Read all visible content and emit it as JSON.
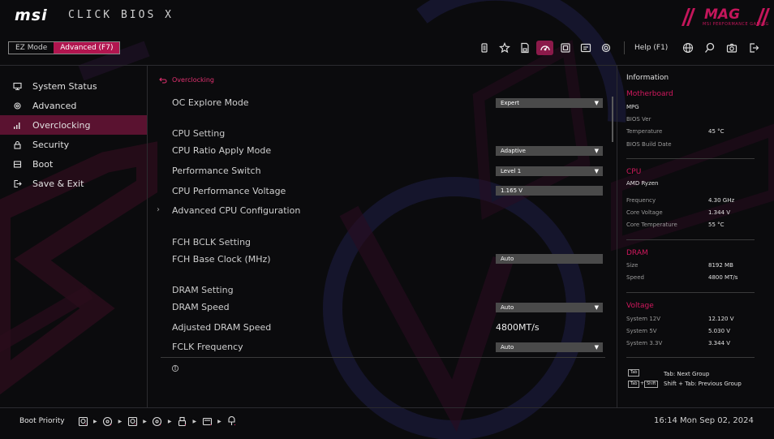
{
  "header": {
    "logo": "msi",
    "title": "CLICK BIOS X",
    "brand": "MAG",
    "brand_tagline": "MSI PERFORMANCE GAMING"
  },
  "mode_switch": {
    "ez_label": "EZ Mode",
    "advanced_label": "Advanced (F7)",
    "active": "advanced"
  },
  "toolbar": {
    "help_label": "Help (F1)"
  },
  "sidebar": {
    "items": [
      {
        "label": "System Status",
        "icon": "monitor-icon"
      },
      {
        "label": "Advanced",
        "icon": "gear-icon"
      },
      {
        "label": "Overclocking",
        "icon": "signal-bars-icon",
        "active": true
      },
      {
        "label": "Security",
        "icon": "lock-icon"
      },
      {
        "label": "Boot",
        "icon": "boot-icon"
      },
      {
        "label": "Save & Exit",
        "icon": "exit-icon"
      }
    ]
  },
  "main": {
    "breadcrumb": "Overclocking",
    "oc_explore_mode": {
      "label": "OC Explore Mode",
      "value": "Expert"
    },
    "cpu_setting_header": "CPU Setting",
    "cpu_ratio_apply_mode": {
      "label": "CPU Ratio Apply Mode",
      "value": "Adaptive"
    },
    "performance_switch": {
      "label": "Performance Switch",
      "value": "Level 1"
    },
    "cpu_performance_voltage": {
      "label": "CPU Performance Voltage",
      "value": "1.165 V"
    },
    "advanced_cpu_config": {
      "label": "Advanced CPU Configuration"
    },
    "fch_header": "FCH BCLK Setting",
    "fch_base_clock": {
      "label": "FCH Base Clock (MHz)",
      "value": "Auto"
    },
    "dram_setting_header": "DRAM Setting",
    "dram_speed": {
      "label": "DRAM Speed",
      "value": "Auto"
    },
    "adjusted_dram_speed": {
      "label": "Adjusted DRAM Speed",
      "value": "4800MT/s"
    },
    "fclk_frequency": {
      "label": "FCLK Frequency",
      "value": "Auto"
    }
  },
  "info": {
    "title": "Information",
    "motherboard": {
      "header": "Motherboard",
      "model": "MPG",
      "bios_ver_label": "BIOS Ver",
      "temperature_label": "Temperature",
      "temperature_value": "45 °C",
      "bios_build_date_label": "BIOS Build Date"
    },
    "cpu": {
      "header": "CPU",
      "model": "AMD Ryzen",
      "frequency_label": "Frequency",
      "frequency_value": "4.30 GHz",
      "core_voltage_label": "Core Voltage",
      "core_voltage_value": "1.344 V",
      "core_temp_label": "Core Temperature",
      "core_temp_value": "55 °C"
    },
    "dram": {
      "header": "DRAM",
      "size_label": "Size",
      "size_value": "8192 MB",
      "speed_label": "Speed",
      "speed_value": "4800 MT/s"
    },
    "voltage": {
      "header": "Voltage",
      "v12_label": "System 12V",
      "v12_value": "12.120 V",
      "v5_label": "System 5V",
      "v5_value": "5.030 V",
      "v33_label": "System 3.3V",
      "v33_value": "3.344 V"
    },
    "keys": {
      "tab_badge": "Tab",
      "shift_badge": "Shift",
      "plus": "+",
      "next_group": "Tab: Next Group",
      "prev_group": "Shift + Tab: Previous Group"
    }
  },
  "footer": {
    "boot_priority_label": "Boot Priority",
    "boot_devices": [
      "hdd-icon",
      "cd-icon",
      "hdd-icon",
      "cd-icon",
      "usb-icon",
      "usb-drive-icon",
      "network-icon"
    ],
    "datetime": "16:14  Mon Sep 02, 2024"
  },
  "colors": {
    "accent": "#c4165b",
    "background": "#0b0b0d",
    "panel_field": "#4a4a4a"
  }
}
